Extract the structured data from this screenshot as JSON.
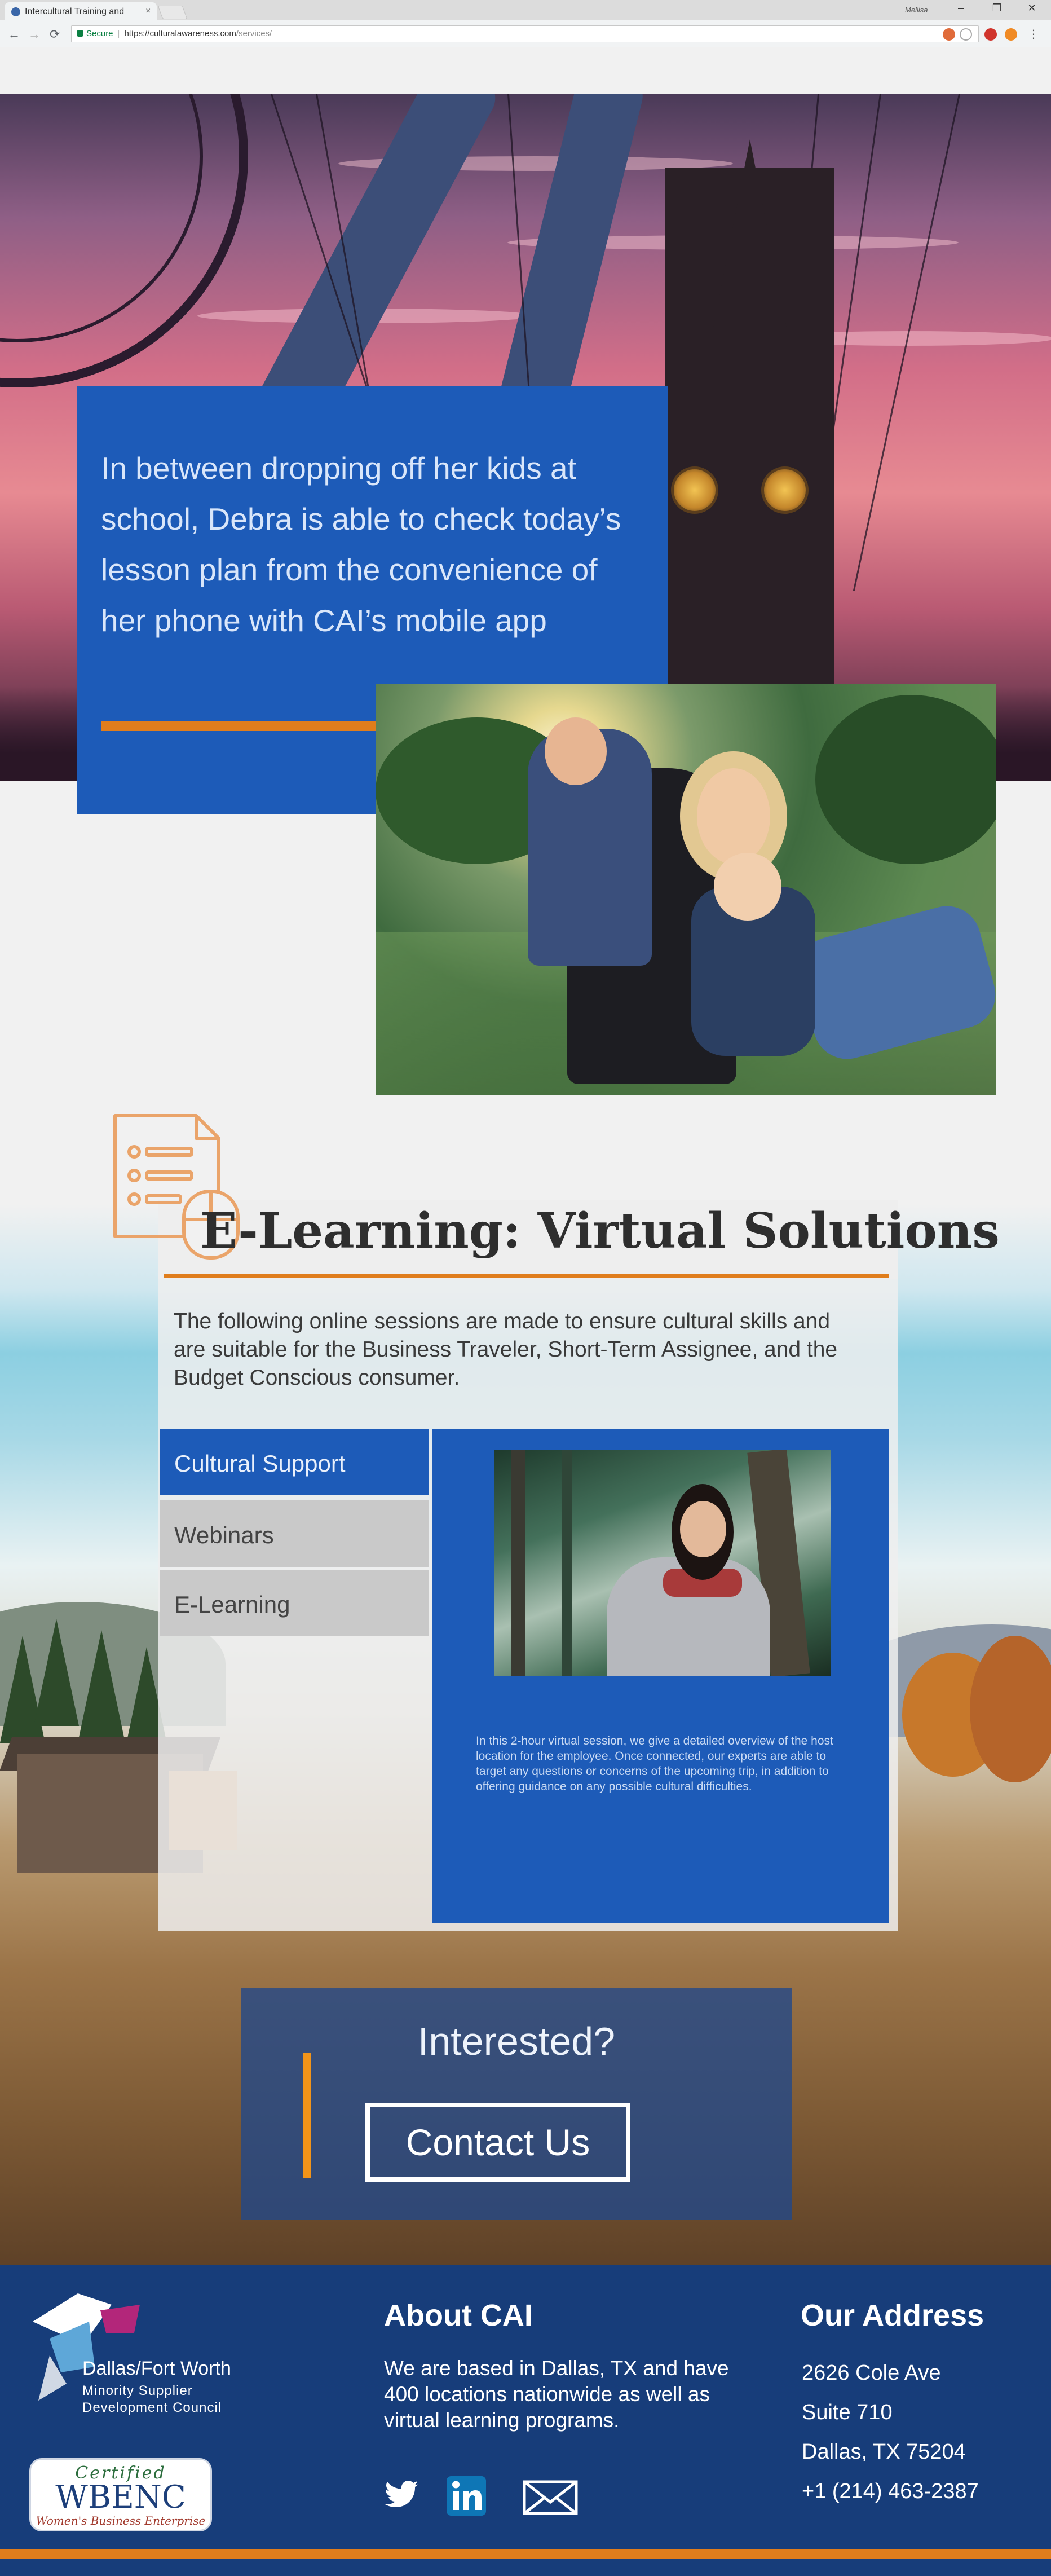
{
  "browser": {
    "tab_title": "Intercultural Training and",
    "tab_close": "×",
    "profile_name": "Mellisa",
    "secure_label": "Secure",
    "url_domain": "https://culturalawareness.com",
    "url_path": "/services/",
    "nav": {
      "back": "←",
      "forward": "→",
      "reload": "⟳"
    },
    "window_controls": {
      "minimize": "–",
      "restore": "❐",
      "close": "✕"
    }
  },
  "hero": {
    "quote": "In between dropping off her kids at school, Debra is able to check today’s lesson plan from the convenience of her phone with CAI’s mobile app",
    "accent_color": "#e07d1c",
    "card_color": "#1d5bb8"
  },
  "elearning": {
    "title": "E-Learning: Virtual Solutions",
    "intro": "The following online sessions are made to ensure cultural skills and are suitable for the Business Traveler, Short-Term Assignee, and the Budget Conscious consumer.",
    "tabs": [
      {
        "label": "Cultural Support",
        "active": true
      },
      {
        "label": "Webinars",
        "active": false
      },
      {
        "label": "E-Learning",
        "active": false
      }
    ],
    "description": "In this 2-hour virtual session, we give a detailed overview of the host location for the employee. Once connected, our experts are able to target any questions or concerns of the upcoming trip, in addition to offering guidance on any possible cultural difficulties.",
    "icon": "document-mouse-icon"
  },
  "cta": {
    "title": "Interested?",
    "button": "Contact Us"
  },
  "footer": {
    "dfw": {
      "line1": "Dallas/Fort Worth",
      "line2": "Minority Supplier",
      "line3": "Development Council"
    },
    "wbenc": {
      "certified": "Certified",
      "name": "WBENC",
      "sub": "Women's Business Enterprise"
    },
    "about": {
      "title": "About CAI",
      "text": "We are based in Dallas, TX and have 400 locations nationwide as well as virtual learning programs."
    },
    "social": [
      "twitter-icon",
      "linkedin-icon",
      "email-icon"
    ],
    "address": {
      "title": "Our Address",
      "street": "2626 Cole Ave",
      "suite": "Suite 710",
      "city": "Dallas, TX 75204",
      "phone": "+1 (214) 463-2387"
    }
  }
}
